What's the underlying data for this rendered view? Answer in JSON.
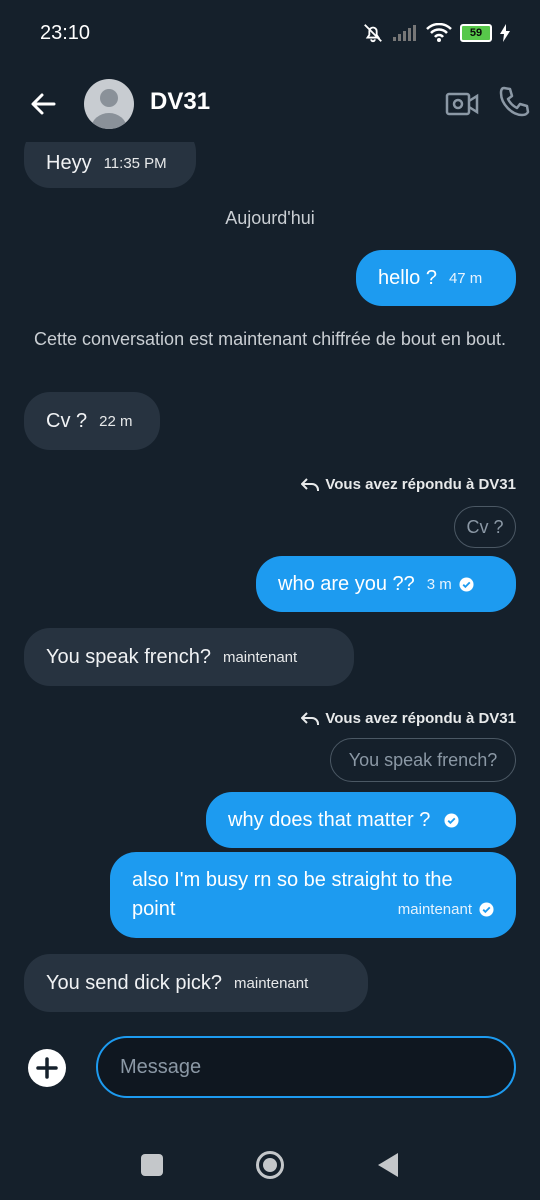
{
  "status_bar": {
    "time": "23:10",
    "battery": "59",
    "icons": [
      "bell-off-icon",
      "signal-icon",
      "wifi-icon",
      "battery-icon",
      "charging-icon"
    ]
  },
  "header": {
    "name": "DV31",
    "back_icon": "arrow-left-icon",
    "video_icon": "video-camera-icon",
    "call_icon": "phone-icon"
  },
  "messages": [
    {
      "from": "them",
      "text": "Heyy",
      "time": "11:35 PM"
    },
    {
      "system": "Aujourd'hui"
    },
    {
      "from": "me",
      "text": "hello ?",
      "time": "47 m"
    },
    {
      "system": "Cette conversation est maintenant chiffrée de bout en bout."
    },
    {
      "from": "them",
      "text": "Cv ?",
      "time": "22 m"
    },
    {
      "reply_note": "Vous avez répondu à DV31",
      "quoted": "Cv ?"
    },
    {
      "from": "me",
      "text": "who are you ??",
      "time": "3 m",
      "read": true
    },
    {
      "from": "them",
      "text": "You speak french?",
      "time": "maintenant"
    },
    {
      "reply_note": "Vous avez répondu à DV31",
      "quoted": "You speak french?"
    },
    {
      "from": "me",
      "text": "why does that matter ?",
      "time": "",
      "read": true
    },
    {
      "from": "me",
      "text": "also I'm busy rn so be straight to the point",
      "time": "maintenant",
      "read": true
    },
    {
      "from": "them",
      "text": "You send dick pick?",
      "time": "maintenant"
    }
  ],
  "composer": {
    "placeholder": "Message",
    "add_icon": "plus-circle-icon"
  },
  "navbar": {
    "icons": [
      "recent-apps-icon",
      "home-icon",
      "back-triangle-icon"
    ]
  },
  "colors": {
    "background": "#15202b",
    "incoming": "#273340",
    "outgoing": "#1d9bf0"
  }
}
